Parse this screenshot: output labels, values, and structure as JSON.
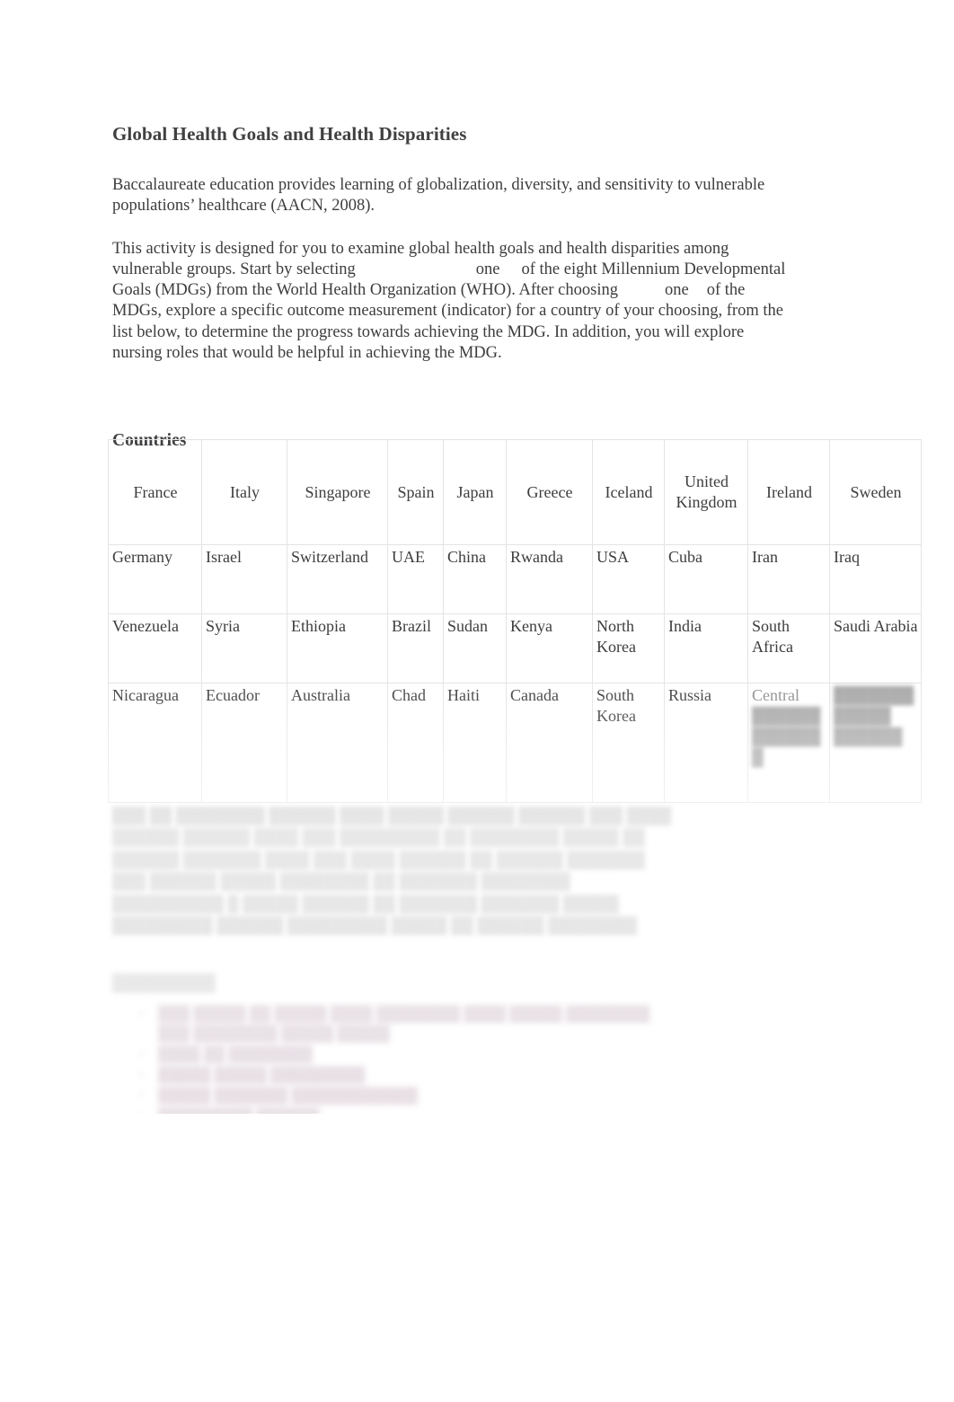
{
  "document": {
    "title": "Global Health Goals and Health Disparities",
    "paragraph_1": "Baccalaureate education provides learning of globalization, diversity, and sensitivity to vulnerable populations’ healthcare (AACN, 2008).",
    "paragraph_2": {
      "seg_1": "This activity is designed for you to examine global health goals and health disparities among vulnerable groups. Start by selecting",
      "emphasis_1": "one",
      "seg_2": "of the eight Millennium Developmental Goals (MDGs) from the World Health Organization (WHO). After choosing",
      "emphasis_2": "one",
      "seg_3": "of the MDGs, explore a specific outcome measurement (indicator) for a country of your choosing, from the list below, to determine the progress towards achieving the MDG. In addition, you will explore nursing roles that would be helpful in achieving the MDG."
    },
    "section_heading": "Countries"
  },
  "countries_table": {
    "rows": [
      {
        "align": "center",
        "cells": [
          "France",
          "Italy",
          "Singapore",
          "Spain",
          "Japan",
          "Greece",
          "Iceland",
          "United Kingdom",
          "Ireland",
          "Sweden"
        ]
      },
      {
        "align": "left",
        "cells": [
          "Germany",
          "Israel",
          "Switzerland",
          "UAE",
          "China",
          "Rwanda",
          "USA",
          "Cuba",
          "Iran",
          "Iraq"
        ]
      },
      {
        "align": "left",
        "cells": [
          "Venezuela",
          "Syria",
          "Ethiopia",
          "Brazil",
          "Sudan",
          "Kenya",
          "North Korea",
          "India",
          "South Africa",
          "Saudi Arabia"
        ]
      },
      {
        "align": "left",
        "cells": [
          "Nicaragua",
          "Ecuador",
          "Australia",
          "Chad",
          "Haiti",
          "Canada",
          "South Korea",
          "Russia",
          "Central",
          ""
        ]
      }
    ]
  },
  "faded_content": {
    "paragraph": "███ ██ ████████ ██████ ████ █████ ██████ ██████ ███ ████ ██████ ██████ ████ ███ █████████ ██ ████████ █████ ██ ██████ ███████ ████ ███ ████ ██████ ██ ██████ ███████ ███ ██████ █████ ████████ ██ ███████ ████████ ██████████ █ █████ ██████ ██ ███████ ███████ █████ █████████ ██████ █████████ █████ ██ ██████ ████████",
    "heading": "█████████",
    "bullets": [
      {
        "marker": "•",
        "text": "███ █████ ██ █████ ████ ████████ ████ █████ ████████ ███ ████████ █████ █████"
      },
      {
        "marker": "•",
        "text": "████ ██ ████████"
      },
      {
        "marker": "•",
        "text": "█████ █████ █████████"
      },
      {
        "marker": "•",
        "text": "█████ ███████ ████████████"
      },
      {
        "marker": "•",
        "text": "█████████ ██████"
      }
    ]
  },
  "colors": {
    "page_background": "#ffffff",
    "body_text": "#3d3d3f",
    "table_border": "#e4e4e6",
    "link_purple": "#9b7a90"
  }
}
